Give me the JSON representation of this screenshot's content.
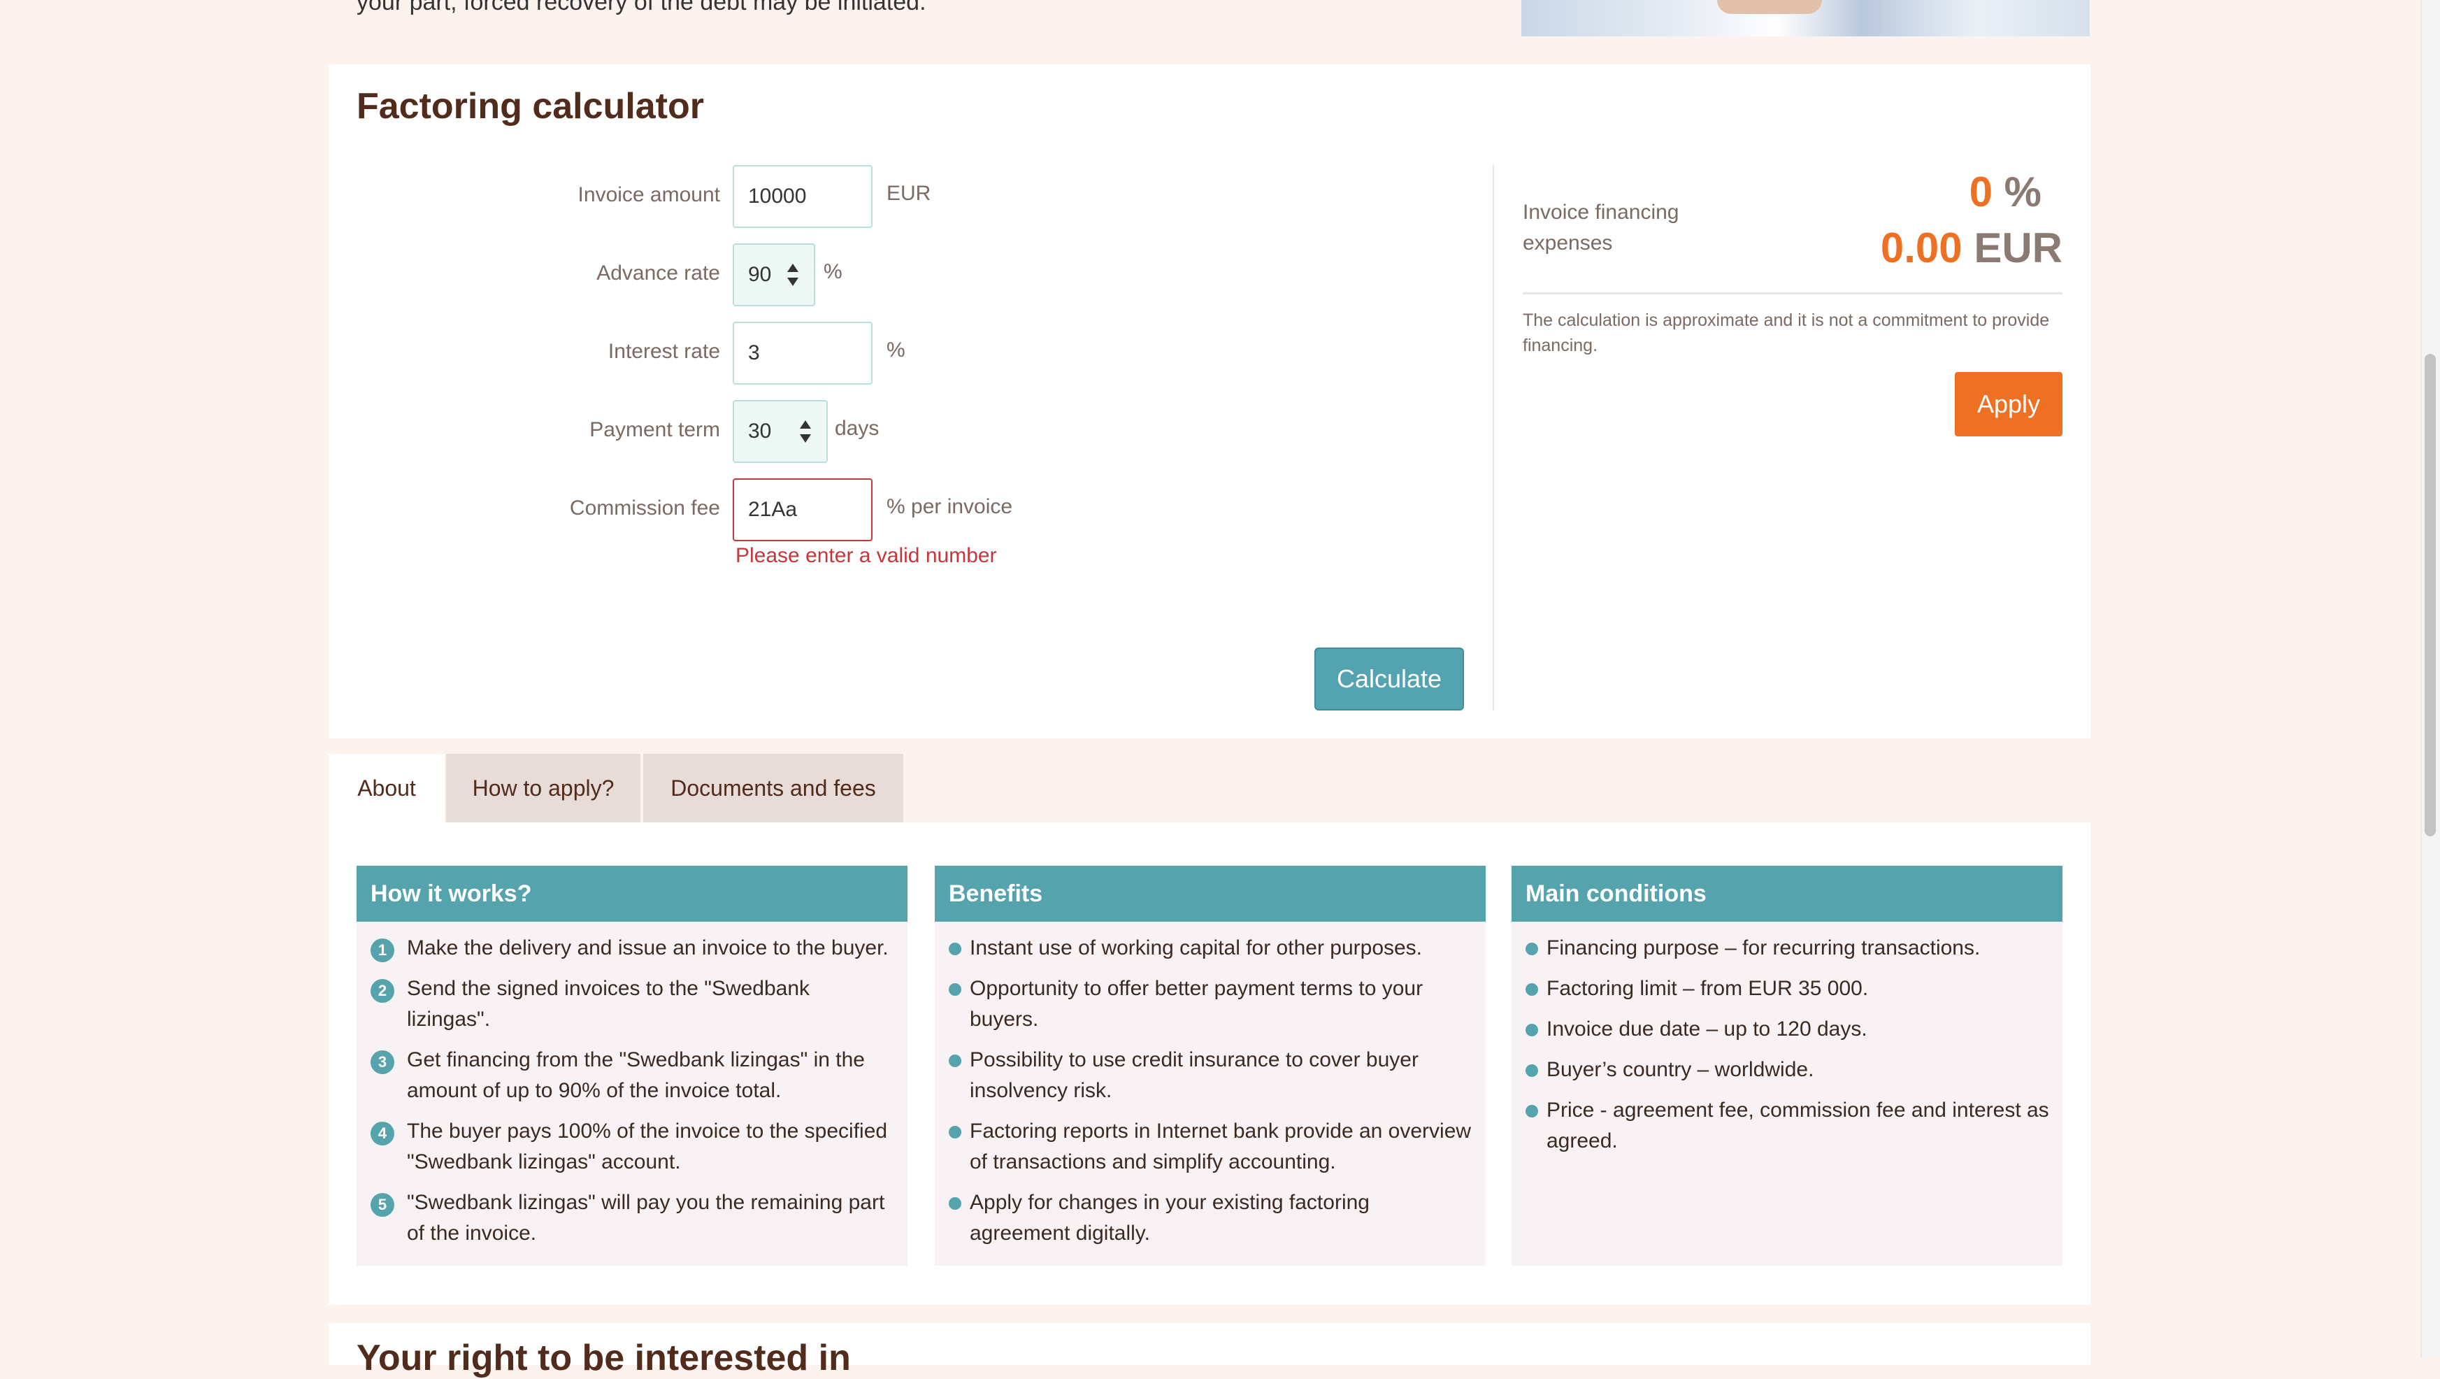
{
  "intro": {
    "text": "your part, forced recovery of the debt may be initiated."
  },
  "calculator": {
    "title": "Factoring calculator",
    "fields": [
      {
        "label": "Invoice amount",
        "value": "10000",
        "unit": "EUR"
      },
      {
        "label": "Advance rate",
        "value": "90",
        "unit": "%"
      },
      {
        "label": "Interest rate",
        "value": "3",
        "unit": "%"
      },
      {
        "label": "Payment term",
        "value": "30",
        "unit": "days"
      },
      {
        "label": "Commission fee",
        "value": "21Aa",
        "unit": "% per invoice"
      }
    ],
    "error": "Please enter a valid number",
    "calculate_label": "Calculate",
    "result": {
      "label": "Invoice financing expenses",
      "percent_value": "0",
      "percent_unit": "%",
      "amount_value": "0.00",
      "amount_unit": "EUR",
      "disclaimer": "The calculation is approximate and it is not a commitment to provide financing.",
      "apply_label": "Apply"
    }
  },
  "tabs": [
    {
      "label": "About",
      "active": true
    },
    {
      "label": "How to apply?",
      "active": false
    },
    {
      "label": "Documents and fees",
      "active": false
    }
  ],
  "panels": {
    "how": {
      "title": "How it works?",
      "items": [
        "Make the delivery and issue an invoice to the buyer.",
        "Send the signed invoices to the \"Swedbank lizingas\".",
        "Get financing from the \"Swedbank lizingas\" in the amount of up to 90% of the invoice total.",
        "The buyer pays 100% of the invoice to the specified \"Swedbank lizingas\" account.",
        "\"Swedbank lizingas\" will pay you the remaining part of the invoice."
      ]
    },
    "benefits": {
      "title": "Benefits",
      "items": [
        "Instant use of working capital for other purposes.",
        "Opportunity to offer better payment terms to your buyers.",
        "Possibility to use credit insurance to cover buyer insolvency risk.",
        "Factoring reports in Internet bank provide an overview of transactions and simplify accounting.",
        "Apply for changes in your existing factoring agreement digitally."
      ]
    },
    "conditions": {
      "title": "Main conditions",
      "items": [
        "Financing purpose – for recurring transactions.",
        "Factoring limit – from EUR 35 000.",
        "Invoice due date – up to 120 days.",
        "Buyer’s country – worldwide.",
        "Price - agreement fee, commission fee and interest as agreed."
      ]
    }
  },
  "bottom": {
    "title": "Your right to be interested in"
  },
  "colors": {
    "brand_brown": "#512b1b",
    "accent_orange": "#ee7023",
    "teal": "#55a3ad",
    "error_red": "#c5373a"
  }
}
